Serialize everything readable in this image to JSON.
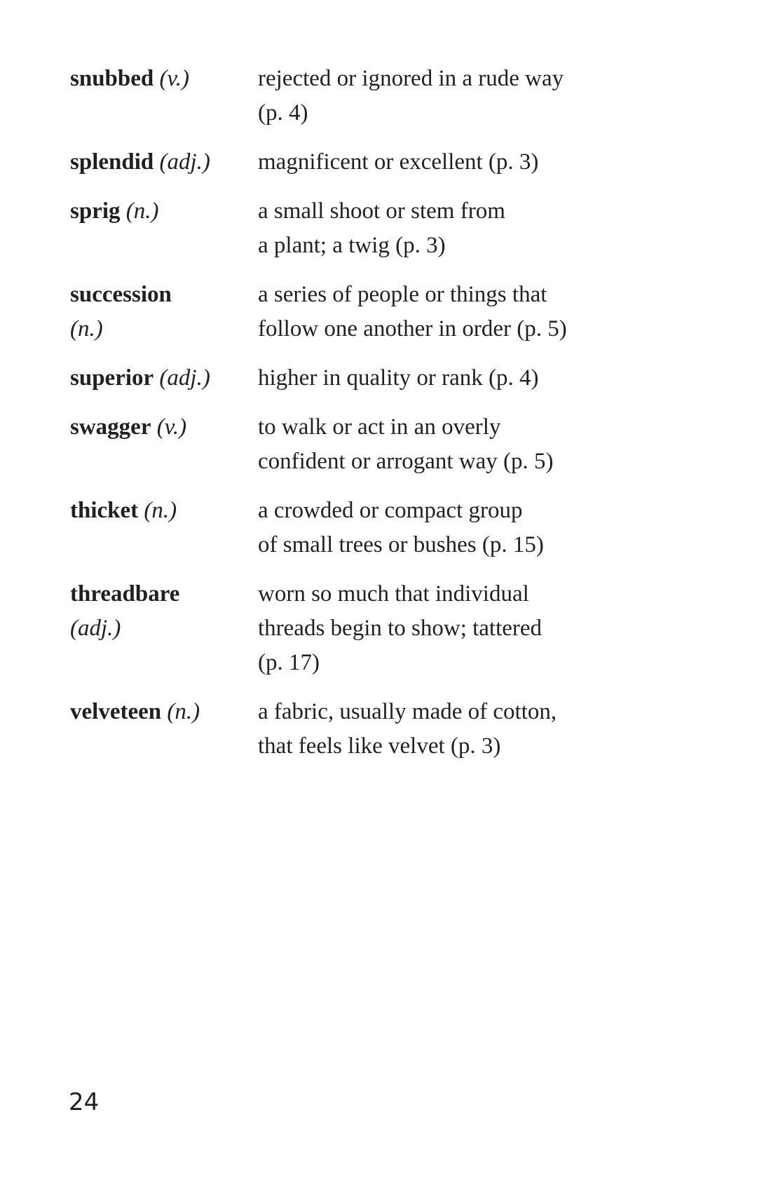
{
  "glossary": {
    "entries": [
      {
        "word": "snubbed",
        "pos": "(v.)",
        "definition_lines": [
          "rejected or ignored in a rude way",
          "(p. 4)"
        ]
      },
      {
        "word": "splendid",
        "pos": "(adj.)",
        "definition_lines": [
          "magnificent or excellent (p. 3)"
        ]
      },
      {
        "word": "sprig",
        "pos": "(n.)",
        "definition_lines": [
          "a small shoot or stem from",
          "a plant; a twig (p. 3)"
        ]
      },
      {
        "word": "succession",
        "pos": "(n.)",
        "definition_lines": [
          "a series of people or things that",
          "follow one another in order (p. 5)"
        ]
      },
      {
        "word": "superior",
        "pos": "(adj.)",
        "definition_lines": [
          "higher in quality or rank (p. 4)"
        ]
      },
      {
        "word": "swagger",
        "pos": "(v.)",
        "definition_lines": [
          "to walk or act in an overly",
          "confident or arrogant way (p. 5)"
        ]
      },
      {
        "word": "thicket",
        "pos": "(n.)",
        "definition_lines": [
          "a crowded or compact group",
          "of small trees or bushes (p. 15)"
        ]
      },
      {
        "word": "threadbare",
        "pos": "(adj.)",
        "definition_lines": [
          "worn so much that individual",
          "threads begin to show; tattered",
          "(p. 17)"
        ]
      },
      {
        "word": "velveteen",
        "pos": "(n.)",
        "definition_lines": [
          "a fabric, usually made of cotton,",
          "that feels like velvet (p. 3)"
        ]
      }
    ]
  },
  "page_number": "24"
}
